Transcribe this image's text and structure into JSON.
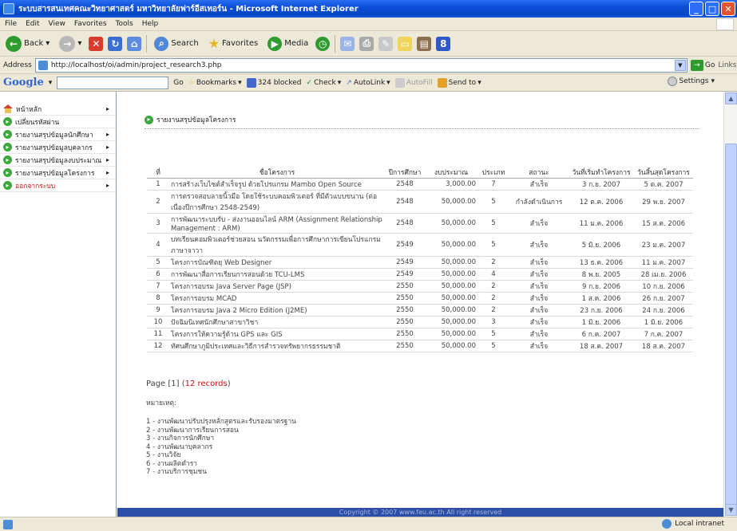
{
  "window": {
    "title": "ระบบสารสนเทศคณะวิทยาศาสตร์ มหาวิทยาลัยฟาร์อีสเทอร์น - Microsoft Internet Explorer"
  },
  "menu": [
    "File",
    "Edit",
    "View",
    "Favorites",
    "Tools",
    "Help"
  ],
  "toolbar": {
    "back": "Back",
    "search": "Search",
    "favorites": "Favorites",
    "media": "Media"
  },
  "address": {
    "label": "Address",
    "url": "http://localhost/oi/admin/project_research3.php",
    "go": "Go",
    "links": "Links"
  },
  "google_bar": {
    "logo": "Google",
    "go": "Go",
    "bookmarks": "Bookmarks",
    "blocked": "324 blocked",
    "check": "Check",
    "autolink": "AutoLink",
    "autofill": "AutoFill",
    "sendto": "Send to",
    "settings": "Settings"
  },
  "sidebar": {
    "items": [
      {
        "label": "หน้าหลัก",
        "arrow": "▸"
      },
      {
        "label": "เปลี่ยนรหัสผ่าน",
        "arrow": ""
      },
      {
        "label": "รายงานสรุปข้อมูลนักศึกษา",
        "arrow": "▸"
      },
      {
        "label": "รายงานสรุปข้อมูลบุคลากร",
        "arrow": "▸"
      },
      {
        "label": "รายงานสรุปข้อมูลงบประมาณ",
        "arrow": "▸"
      },
      {
        "label": "รายงานสรุปข้อมูลโครงการ",
        "arrow": "▸"
      },
      {
        "label": "ออกจากระบบ",
        "arrow": "▸"
      }
    ]
  },
  "main": {
    "heading": "รายงานสรุปข้อมูลโครงการ",
    "table": {
      "headers": [
        "ที่",
        "ชื่อโครงการ",
        "ปีการศึกษา",
        "งบประมาณ",
        "ประเภท",
        "สถานะ",
        "วันที่เริ่มทำโครงการ",
        "วันสิ้นสุดโครงการ"
      ],
      "rows": [
        [
          "1",
          "การสร้างเว็บไซต์สำเร็จรูป ด้วยโปรแกรม Mambo Open Source",
          "2548",
          "3,000.00",
          "7",
          "สำเร็จ",
          "3 ก.ย. 2007",
          "5 ต.ค. 2007"
        ],
        [
          "2",
          "การตรวจสอบลายนิ้วมือ โดยใช้ระบบคอมพิวเตอร์ ที่มีตัวแบบขนาน (ต่อเนื่องปีการศึกษา 2548-2549)",
          "2548",
          "50,000.00",
          "5",
          "กำลังดำเนินการ",
          "12 ต.ค. 2006",
          "29 พ.ย. 2007"
        ],
        [
          "3",
          "การพัฒนาระบบรับ - ส่งงานออนไลน์ ARM (Assignment Relationship Management : ARM)",
          "2548",
          "50,000.00",
          "5",
          "สำเร็จ",
          "11 ม.ค. 2006",
          "15 ส.ค. 2006"
        ],
        [
          "4",
          "บทเรียนคอมพิวเตอร์ช่วยสอน นวัตกรรมเพื่อการศึกษาการเขียนโปรแกรมภาษาจาวา",
          "2549",
          "50,000.00",
          "5",
          "สำเร็จ",
          "5 มิ.ย. 2006",
          "23 ม.ค. 2007"
        ],
        [
          "5",
          "โครงการบัณฑิตยุ Web Designer",
          "2549",
          "50,000.00",
          "2",
          "สำเร็จ",
          "13 ธ.ค. 2006",
          "11 ม.ค. 2007"
        ],
        [
          "6",
          "การพัฒนาสื่อการเรียนการสอนด้วย TCU-LMS",
          "2549",
          "50,000.00",
          "4",
          "สำเร็จ",
          "8 พ.ย. 2005",
          "28 เม.ย. 2006"
        ],
        [
          "7",
          "โครงการอบรม Java Server Page (JSP)",
          "2550",
          "50,000.00",
          "2",
          "สำเร็จ",
          "9 ก.ย. 2006",
          "10 ก.ย. 2006"
        ],
        [
          "8",
          "โครงการอบรม MCAD",
          "2550",
          "50,000.00",
          "2",
          "สำเร็จ",
          "1 ส.ค. 2006",
          "26 ก.ย. 2007"
        ],
        [
          "9",
          "โครงการอบรม Java 2 Micro Edition (J2ME)",
          "2550",
          "50,000.00",
          "2",
          "สำเร็จ",
          "23 ก.ย. 2006",
          "24 ก.ย. 2006"
        ],
        [
          "10",
          "ปัจฉิมนิเทศนักศึกษาสาขาวิชา",
          "2550",
          "50,000.00",
          "3",
          "สำเร็จ",
          "1 มิ.ย. 2006",
          "1 มิ.ย. 2006"
        ],
        [
          "11",
          "โครงการให้ความรู้ด้าน GPS และ GIS",
          "2550",
          "50,000.00",
          "5",
          "สำเร็จ",
          "6 ก.ค. 2007",
          "7 ก.ค. 2007"
        ],
        [
          "12",
          "ทัศนศึกษาภูมิประเทศและวิธีการสำรวจทรัพยากรธรรมชาติ",
          "2550",
          "50,000.00",
          "5",
          "สำเร็จ",
          "18 ส.ค. 2007",
          "18 ส.ค. 2007"
        ]
      ]
    },
    "page_prefix": "Page [1] (",
    "records": "12 records",
    "page_suffix": ")",
    "note_label": "หมายเหตุ:",
    "notes": [
      "1 - งานพัฒนาปรับปรุงหลักสูตรและรับรองมาตรฐาน",
      "2 - งานพัฒนาการเรียนการสอน",
      "3 - งานกิจการนักศึกษา",
      "4 - งานพัฒนาบุคลากร",
      "5 - งานวิจัย",
      "6 - งานผลิตตำรา",
      "7 - งานบริการชุมชน"
    ],
    "footer": "Copyright © 2007 www.feu.ac.th All right reserved"
  },
  "status": {
    "zone": "Local intranet"
  }
}
